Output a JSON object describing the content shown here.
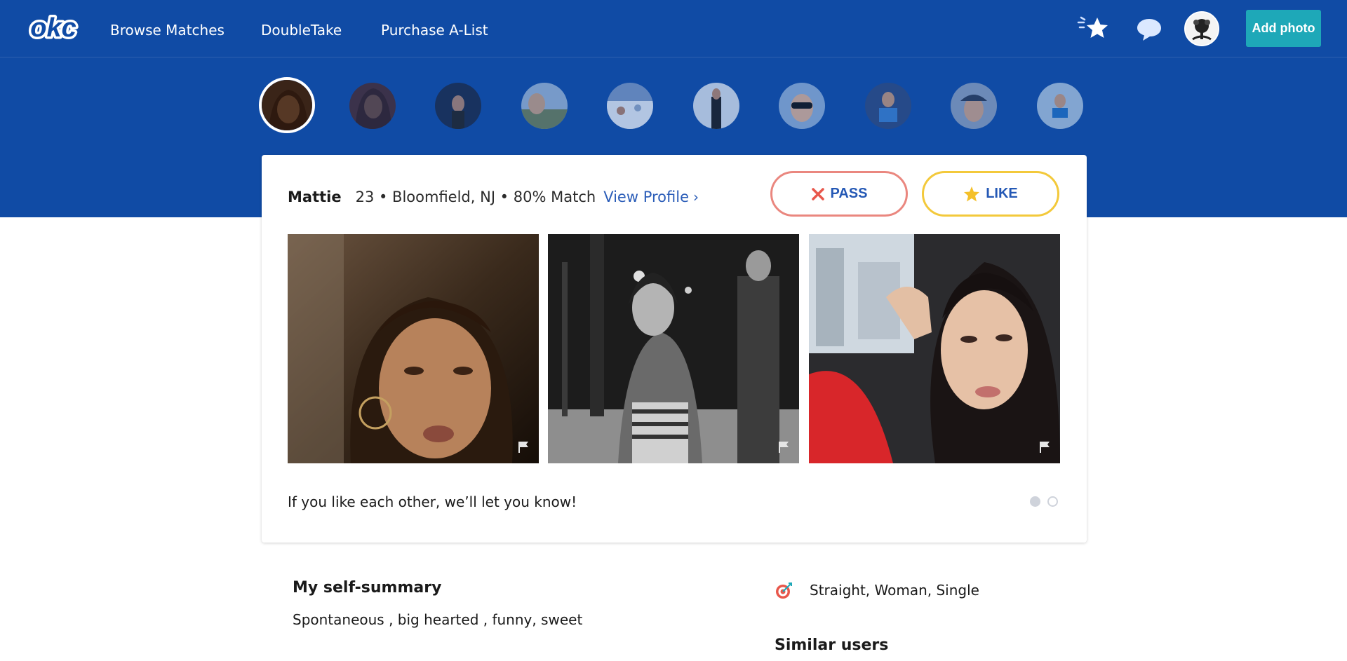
{
  "nav": {
    "logo_text": "okc",
    "links": [
      "Browse Matches",
      "DoubleTake",
      "Purchase A-List"
    ],
    "icons": [
      "likes-star-icon",
      "messages-bubble-icon"
    ],
    "add_photo_label": "Add photo"
  },
  "profile": {
    "name": "Mattie",
    "meta": "23 • Bloomfield, NJ • 80% Match",
    "view_profile_label": "View Profile"
  },
  "actions": {
    "pass_label": "PASS",
    "like_label": "LIKE"
  },
  "notice": "If you like each other, we’ll let you know!",
  "pager": {
    "count": 2,
    "active": 1
  },
  "summary": {
    "title": "My self-summary",
    "text": "Spontaneous , big hearted , funny, sweet"
  },
  "details": {
    "text": "Straight, Woman, Single",
    "icon": "target-icon"
  },
  "similar": {
    "title": "Similar users"
  },
  "colors": {
    "brand_blue": "#104ba5",
    "link_blue": "#2b5db8",
    "add_photo_teal": "#1ea8b8",
    "pass_border": "#ea877f",
    "like_border": "#f3c93b",
    "pass_x": "#e8574b",
    "like_star": "#f4c02a"
  }
}
